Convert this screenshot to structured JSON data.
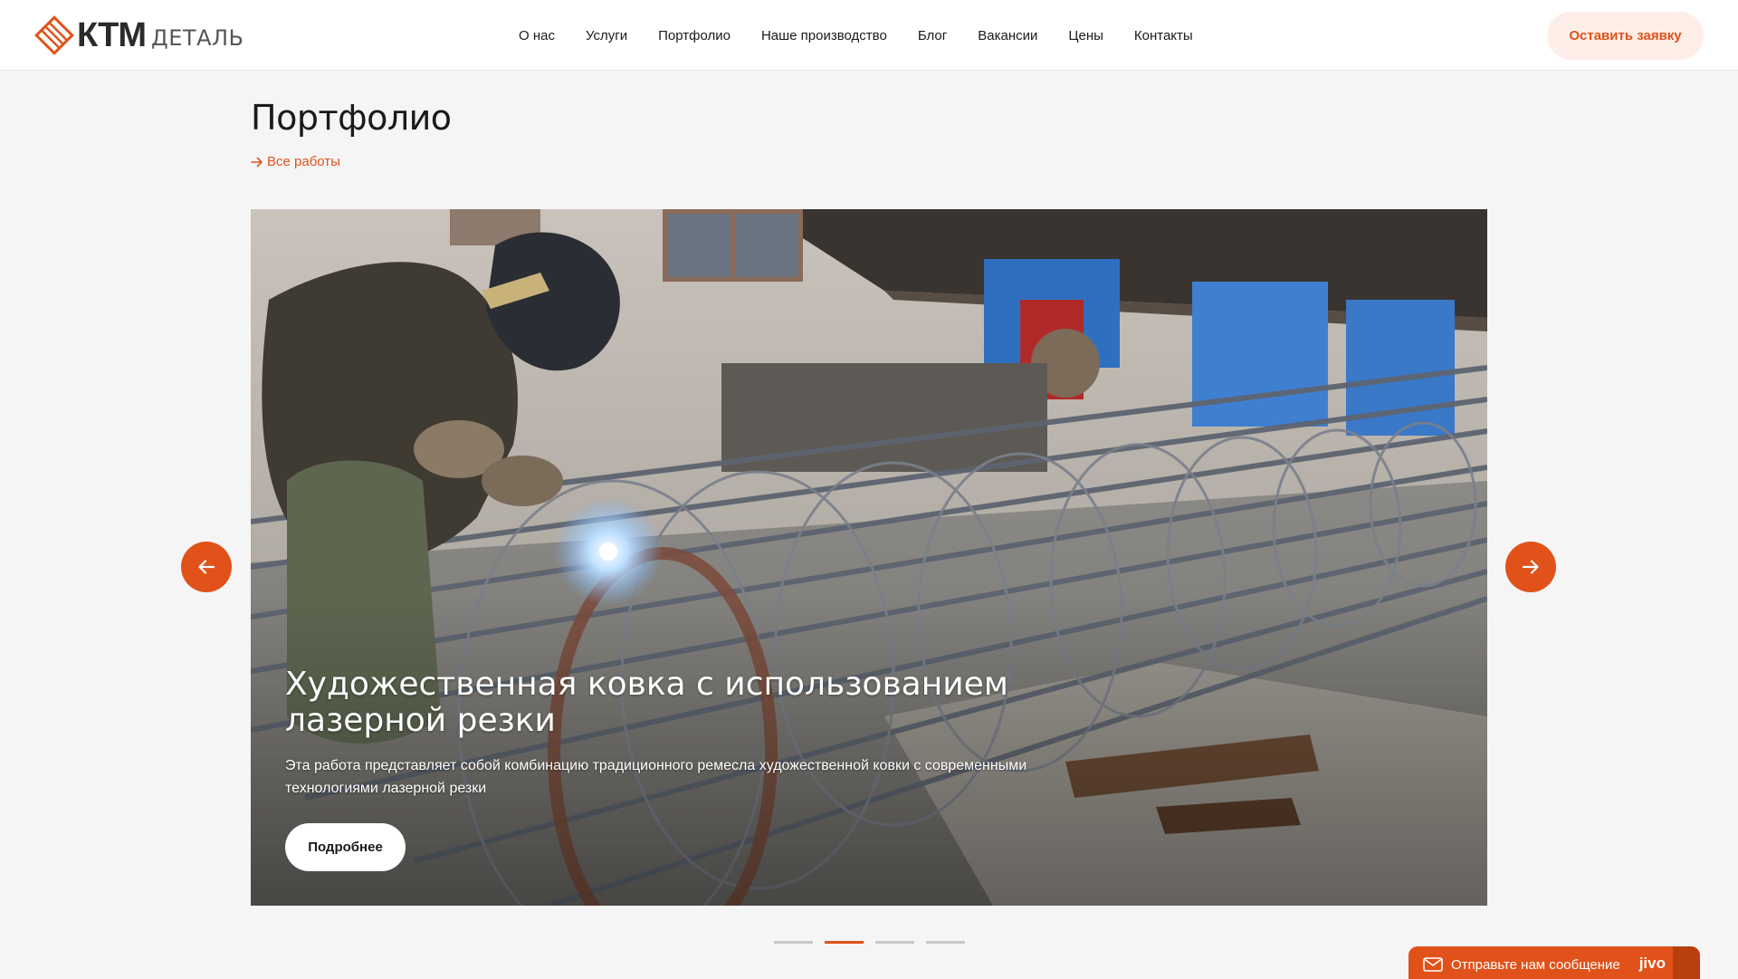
{
  "header": {
    "logo": {
      "brand": "КТМ",
      "sub": "ДЕТАЛЬ"
    },
    "nav": [
      {
        "label": "О нас"
      },
      {
        "label": "Услуги"
      },
      {
        "label": "Портфолио"
      },
      {
        "label": "Наше производство"
      },
      {
        "label": "Блог"
      },
      {
        "label": "Вакансии"
      },
      {
        "label": "Цены"
      },
      {
        "label": "Контакты"
      }
    ],
    "cta_label": "Оставить заявку"
  },
  "page": {
    "title": "Портфолио",
    "all_works_label": "Все работы"
  },
  "slider": {
    "current_slide": 2,
    "total_slides": 4,
    "slide": {
      "title": "Художественная ковка с использованием лазерной резки",
      "description": "Эта работа представляет собой комбинацию традиционного ремесла художественной ковки с современными технологиями лазерной резки",
      "button_label": "Подробнее",
      "image": "welder-rebar-cage-photo"
    },
    "prev_icon": "arrow-left-icon",
    "next_icon": "arrow-right-icon"
  },
  "chat_widget": {
    "label": "Отправьте нам сообщение",
    "brand": "jivo",
    "icon": "envelope-icon"
  },
  "colors": {
    "accent": "#e0521a",
    "accent_light": "#fdeee8",
    "background": "#f5f5f6",
    "header_bg": "#ffffff",
    "text": "#1a1a1a"
  }
}
